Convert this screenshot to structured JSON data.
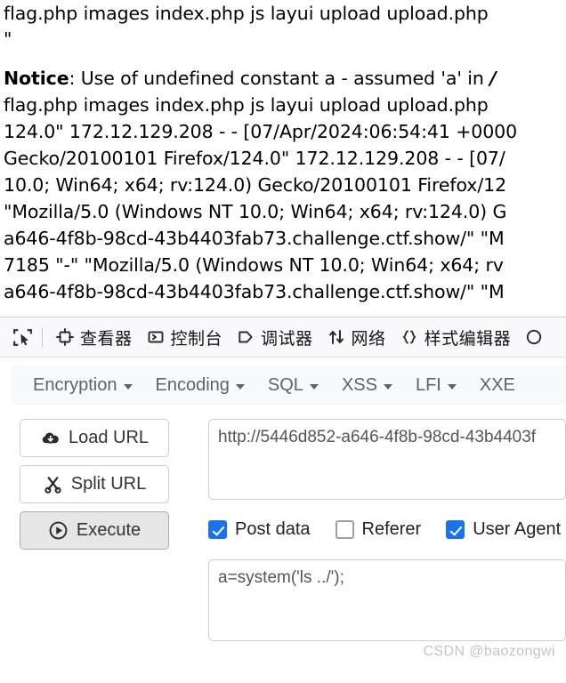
{
  "page_output": {
    "lines": [
      {
        "id": "line-ls-output-1",
        "text": "flag.php images index.php js layui upload upload.php "
      },
      {
        "id": "line-quote",
        "text": "\""
      },
      {
        "id": "line-spacer",
        "text": ""
      },
      {
        "id": "line-notice",
        "label": "Notice",
        "text": ": Use of undefined constant a - assumed 'a' in ",
        "path": "/"
      },
      {
        "id": "line-ls-output-2",
        "text": "flag.php images index.php js layui upload upload.php "
      },
      {
        "id": "line-log-1",
        "text": "124.0\" 172.12.129.208 - - [07/Apr/2024:06:54:41 +0000"
      },
      {
        "id": "line-log-2",
        "text": "Gecko/20100101 Firefox/124.0\" 172.12.129.208 - - [07/"
      },
      {
        "id": "line-log-3",
        "text": "10.0; Win64; x64; rv:124.0) Gecko/20100101 Firefox/12"
      },
      {
        "id": "line-log-4",
        "text": "\"Mozilla/5.0 (Windows NT 10.0; Win64; x64; rv:124.0) G"
      },
      {
        "id": "line-log-5",
        "text": "a646-4f8b-98cd-43b4403fab73.challenge.ctf.show/\" \"M"
      },
      {
        "id": "line-log-6",
        "text": "7185 \"-\" \"Mozilla/5.0 (Windows NT 10.0; Win64; x64; rv"
      },
      {
        "id": "line-log-7",
        "text": "a646-4f8b-98cd-43b4403fab73.challenge.ctf.show/\" \"M"
      }
    ]
  },
  "devtools": {
    "picker_icon": "element-picker-icon",
    "tabs": [
      {
        "label": "查看器",
        "icon": "inspector-icon",
        "name": "tab-inspector"
      },
      {
        "label": "控制台",
        "icon": "console-icon",
        "name": "tab-console"
      },
      {
        "label": "调试器",
        "icon": "debugger-icon",
        "name": "tab-debugger"
      },
      {
        "label": "网络",
        "icon": "network-icon",
        "name": "tab-network"
      },
      {
        "label": "样式编辑器",
        "icon": "style-editor-icon",
        "name": "tab-style-editor"
      }
    ],
    "overflow_icon": "performance-icon"
  },
  "hackbar": {
    "menus": [
      {
        "label": "Encryption",
        "name": "menu-encryption"
      },
      {
        "label": "Encoding",
        "name": "menu-encoding"
      },
      {
        "label": "SQL",
        "name": "menu-sql"
      },
      {
        "label": "XSS",
        "name": "menu-xss"
      },
      {
        "label": "LFI",
        "name": "menu-lfi"
      },
      {
        "label": "XXE",
        "name": "menu-xxe"
      }
    ],
    "buttons": [
      {
        "label": "Load URL",
        "icon": "cloud-download-icon",
        "name": "load-url-button",
        "pressed": false
      },
      {
        "label": "Split URL",
        "icon": "scissors-icon",
        "name": "split-url-button",
        "pressed": false
      },
      {
        "label": "Execute",
        "icon": "play-circle-icon",
        "name": "execute-button",
        "pressed": true
      }
    ],
    "url_field": {
      "value": "http://5446d852-a646-4f8b-98cd-43b4403f",
      "placeholder": "URL"
    },
    "checkboxes": [
      {
        "label": "Post data",
        "checked": true,
        "name": "post-data-checkbox"
      },
      {
        "label": "Referer",
        "checked": false,
        "name": "referer-checkbox"
      },
      {
        "label": "User Agent",
        "checked": true,
        "name": "user-agent-checkbox"
      }
    ],
    "post_field": {
      "value": "a=system('ls ../');",
      "placeholder": "Post data"
    }
  },
  "watermark": {
    "text": "CSDN @baozongwi"
  },
  "colors": {
    "accent_blue": "#1a73e8",
    "toolbar_bg": "#f8f9fa",
    "devtools_bg": "#f9f9fb",
    "menu_text": "#5f6368",
    "pressed_button": "#e6e6e6"
  }
}
